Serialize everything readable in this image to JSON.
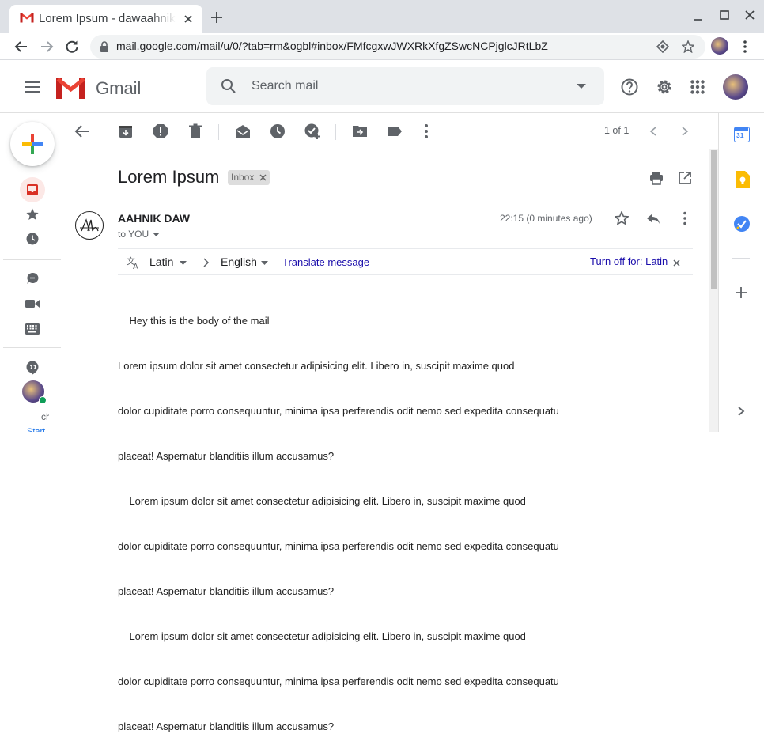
{
  "browser": {
    "tab_title": "Lorem Ipsum - dawaahnik",
    "url": "mail.google.com/mail/u/0/?tab=rm&ogbl#inbox/FMfcgxwJWXRkXfgZSwcNCPjglcJRtLbZ"
  },
  "gmail": {
    "logo_text": "Gmail",
    "search_placeholder": "Search mail"
  },
  "toolbar": {
    "pagination": "1 of 1"
  },
  "email": {
    "subject": "Lorem Ipsum",
    "label": "Inbox",
    "sender": "AAHNIK DAW",
    "time": "22:15 (0 minutes ago)",
    "to": "to YOU",
    "body_lines": [
      "    Hey this is the body of the mail",
      "Lorem ipsum dolor sit amet consectetur adipisicing elit. Libero in, suscipit maxime quod",
      "dolor cupiditate porro consequuntur, minima ipsa perferendis odit nemo sed expedita consequatu",
      "placeat! Aspernatur blanditiis illum accusamus?",
      "    Lorem ipsum dolor sit amet consectetur adipisicing elit. Libero in, suscipit maxime quod",
      "dolor cupiditate porro consequuntur, minima ipsa perferendis odit nemo sed expedita consequatu",
      "placeat! Aspernatur blanditiis illum accusamus?",
      "    Lorem ipsum dolor sit amet consectetur adipisicing elit. Libero in, suscipit maxime quod",
      "dolor cupiditate porro consequuntur, minima ipsa perferendis odit nemo sed expedita consequatu",
      "placeat! Aspernatur blanditiis illum accusamus?"
    ]
  },
  "translate": {
    "from_lang": "Latin",
    "to_lang": "English",
    "translate_link": "Translate message",
    "turn_off": "Turn off for: Latin"
  },
  "rail": {
    "chat_partial": "ch",
    "start_partial": "Start"
  },
  "sidepanel": {
    "calendar_day": "31"
  },
  "colors": {
    "gmail_red": "#ea4335",
    "link_blue": "#1a0dab",
    "translate_blue": "#1a73e8",
    "keep_yellow": "#fbbc04",
    "tasks_blue": "#4285f4"
  }
}
